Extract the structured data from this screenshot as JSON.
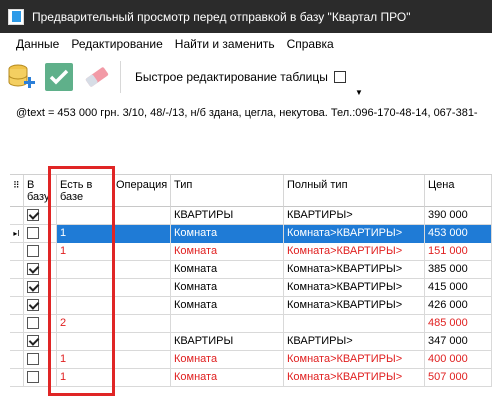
{
  "window": {
    "title": "Предварительный просмотр перед отправкой в базу \"Квартал ПРО\""
  },
  "menu": [
    "Данные",
    "Редактирование",
    "Найти и заменить",
    "Справка"
  ],
  "toolbar": {
    "quick_edit_label": "Быстрое редактирование таблицы"
  },
  "info_text": "@text = 453 000 грн. 3/10, 48/-/13, н/б здана, цегла, некутова. Тел.:096-170-48-14, 067-381-",
  "columns": [
    "В базу",
    "Есть в базе",
    "Операция",
    "Тип",
    "Полный тип",
    "Цена"
  ],
  "rows": [
    {
      "in_db": true,
      "exists": "",
      "op": "",
      "type": "КВАРТИРЫ",
      "full": "КВАРТИРЫ>",
      "price": "390 000",
      "red": false,
      "selected": false
    },
    {
      "in_db": false,
      "exists": "1",
      "op": "",
      "type": "Комната",
      "full": "Комната>КВАРТИРЫ>",
      "price": "453 000",
      "red": false,
      "selected": true
    },
    {
      "in_db": false,
      "exists": "1",
      "op": "",
      "type": "Комната",
      "full": "Комната>КВАРТИРЫ>",
      "price": "151 000",
      "red": true,
      "selected": false
    },
    {
      "in_db": true,
      "exists": "",
      "op": "",
      "type": "Комната",
      "full": "Комната>КВАРТИРЫ>",
      "price": "385 000",
      "red": false,
      "selected": false
    },
    {
      "in_db": true,
      "exists": "",
      "op": "",
      "type": "Комната",
      "full": "Комната>КВАРТИРЫ>",
      "price": "415 000",
      "red": false,
      "selected": false
    },
    {
      "in_db": true,
      "exists": "",
      "op": "",
      "type": "Комната",
      "full": "Комната>КВАРТИРЫ>",
      "price": "426 000",
      "red": false,
      "selected": false
    },
    {
      "in_db": false,
      "exists": "2",
      "op": "",
      "type": "",
      "full": "",
      "price": "485 000",
      "red": true,
      "selected": false
    },
    {
      "in_db": true,
      "exists": "",
      "op": "",
      "type": "КВАРТИРЫ",
      "full": "КВАРТИРЫ>",
      "price": "347 000",
      "red": false,
      "selected": false
    },
    {
      "in_db": false,
      "exists": "1",
      "op": "",
      "type": "Комната",
      "full": "Комната>КВАРТИРЫ>",
      "price": "400 000",
      "red": true,
      "selected": false
    },
    {
      "in_db": false,
      "exists": "1",
      "op": "",
      "type": "Комната",
      "full": "Комната>КВАРТИРЫ>",
      "price": "507 000",
      "red": true,
      "selected": false
    }
  ],
  "colors": {
    "selection": "#1f7bd6",
    "red_text": "#e02020",
    "annotation": "#e02525"
  }
}
